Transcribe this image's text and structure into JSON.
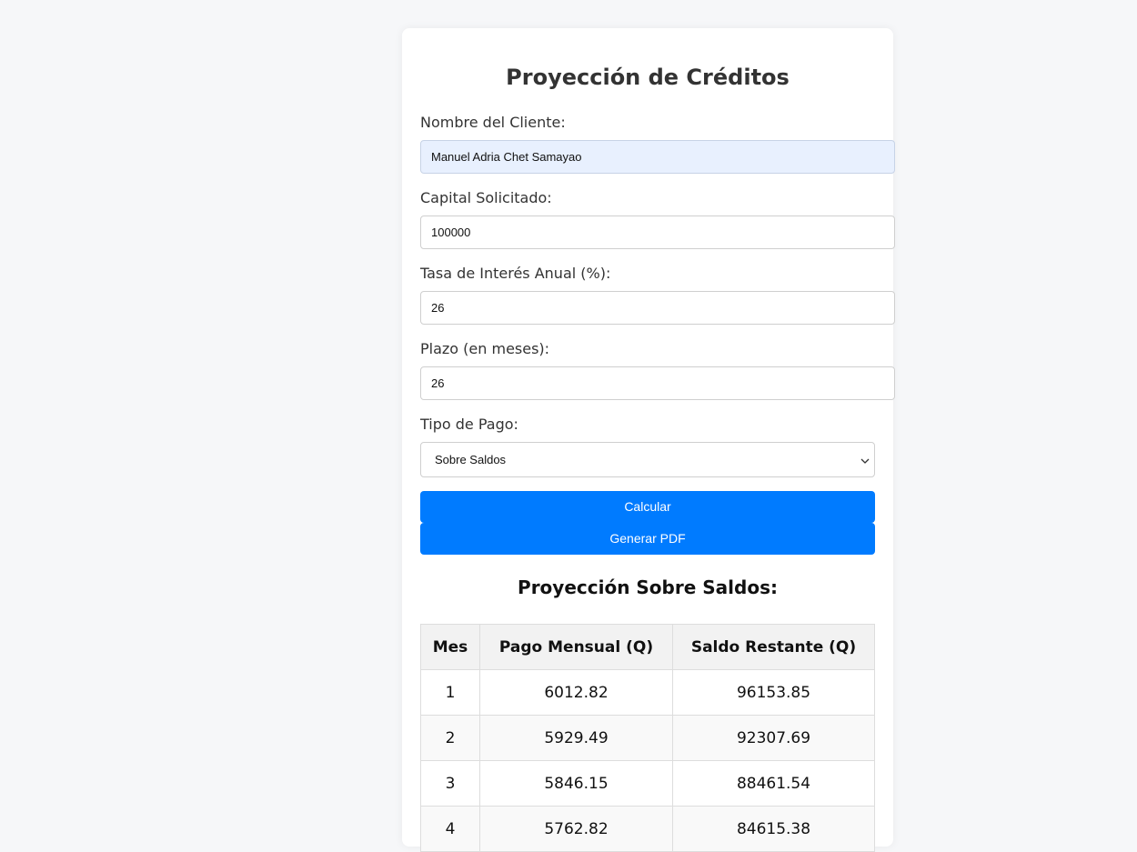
{
  "title": "Proyección de Créditos",
  "form": {
    "cliente": {
      "label": "Nombre del Cliente:",
      "value": "Manuel Adria Chet Samayao"
    },
    "capital": {
      "label": "Capital Solicitado:",
      "value": "100000"
    },
    "tasa": {
      "label": "Tasa de Interés Anual (%):",
      "value": "26"
    },
    "plazo": {
      "label": "Plazo (en meses):",
      "value": "26"
    },
    "tipo": {
      "label": "Tipo de Pago:",
      "selected": "Sobre Saldos"
    }
  },
  "buttons": {
    "calcular": "Calcular",
    "pdf": "Generar PDF"
  },
  "results": {
    "heading": "Proyección Sobre Saldos:",
    "columns": [
      "Mes",
      "Pago Mensual (Q)",
      "Saldo Restante (Q)"
    ],
    "rows": [
      [
        "1",
        "6012.82",
        "96153.85"
      ],
      [
        "2",
        "5929.49",
        "92307.69"
      ],
      [
        "3",
        "5846.15",
        "88461.54"
      ],
      [
        "4",
        "5762.82",
        "84615.38"
      ]
    ]
  },
  "colors": {
    "button": "#007bff",
    "autofill_bg": "#e8f0fe"
  }
}
